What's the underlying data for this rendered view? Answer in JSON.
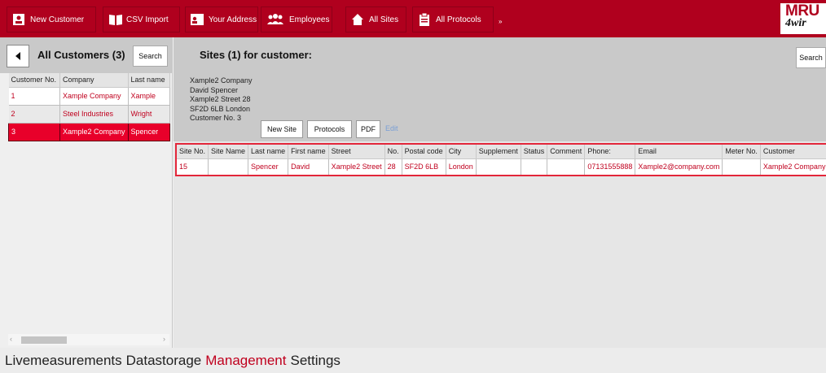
{
  "toolbar": {
    "buttons": [
      {
        "label": "New Customer",
        "icon": "contact-card-icon"
      },
      {
        "label": "CSV Import",
        "icon": "open-book-icon"
      },
      {
        "label": "Your Address",
        "icon": "id-card-icon"
      },
      {
        "label": "Employees",
        "icon": "people-icon"
      },
      {
        "label": "All Sites",
        "icon": "home-icon"
      },
      {
        "label": "All Protocols",
        "icon": "clipboard-icon"
      }
    ],
    "more_glyph": "»",
    "logo_line1": "MRU",
    "logo_line2": "4wir"
  },
  "customers": {
    "title": "All Customers (3)",
    "search_label": "Search",
    "columns": [
      "Customer No.",
      "Company",
      "Last name"
    ],
    "rows": [
      [
        "1",
        "Xample Company",
        "Xample"
      ],
      [
        "2",
        "Steel Industries",
        "Wright"
      ],
      [
        "3",
        "Xample2 Company",
        "Spencer"
      ]
    ],
    "selected_index": 2
  },
  "sites": {
    "title": "Sites (1) for customer:",
    "search_label": "Search",
    "address": [
      "Xample2 Company",
      "David Spencer",
      "Xample2 Street 28",
      "SF2D 6LB London",
      "Customer No. 3"
    ],
    "buttons": {
      "new_site": "New Site",
      "protocols": "Protocols",
      "pdf": "PDF",
      "edit": "Edit"
    },
    "columns": [
      "Site No.",
      "Site Name",
      "Last name",
      "First name",
      "Street",
      "No.",
      "Postal code",
      "City",
      "Supplement",
      "Status",
      "Comment",
      "Phone:",
      "Email",
      "Meter No.",
      "Customer"
    ],
    "rows": [
      [
        "15",
        "",
        "Spencer",
        "David",
        "Xample2 Street",
        "28",
        "SF2D 6LB",
        "London",
        "",
        "",
        "",
        "07131555888",
        "Xample2@company.com",
        "",
        "Xample2 Company"
      ]
    ]
  },
  "bottom_nav": {
    "items": [
      "Livemeasurements",
      "Datastorage",
      "Management",
      "Settings"
    ],
    "active": "Management"
  },
  "colors": {
    "brand": "#b0001e",
    "selection": "#e8002a",
    "link": "#7a9fd6"
  }
}
